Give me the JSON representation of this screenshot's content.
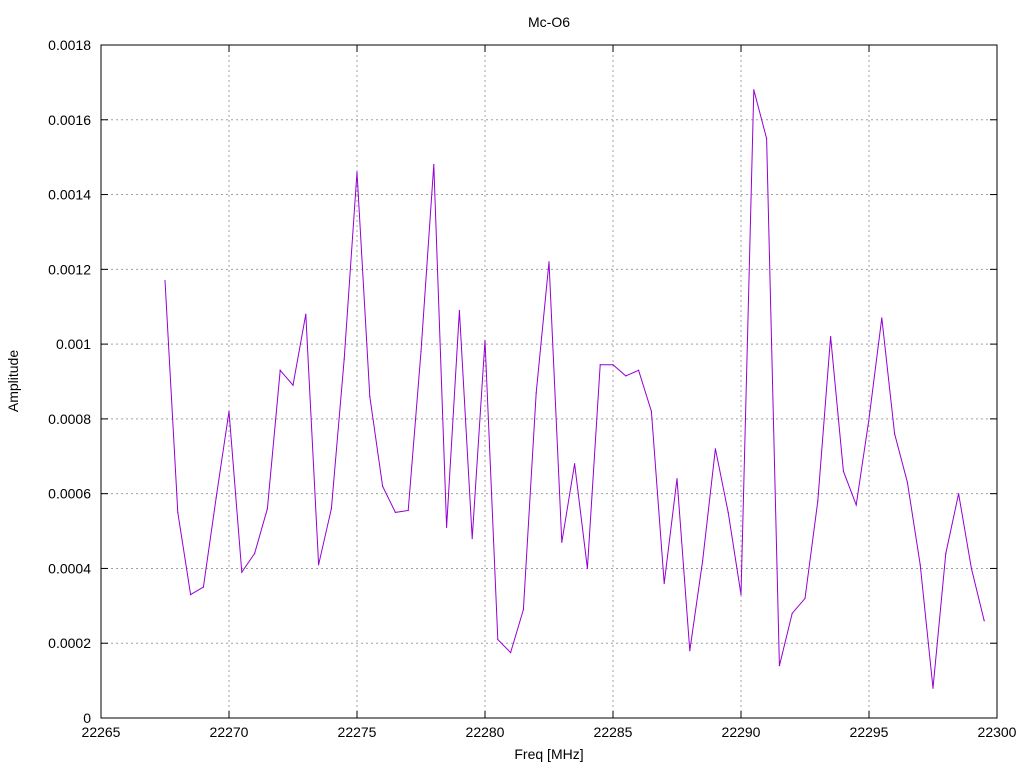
{
  "chart_data": {
    "type": "line",
    "title": "Mc-O6",
    "xlabel": "Freq [MHz]",
    "ylabel": "Amplitude",
    "xlim": [
      22265,
      22300
    ],
    "ylim": [
      0,
      0.0018
    ],
    "x_ticks": [
      "22265",
      "22270",
      "22275",
      "22280",
      "22285",
      "22290",
      "22295",
      "22300"
    ],
    "y_ticks": [
      "0",
      "0.0002",
      "0.0004",
      "0.0006",
      "0.0008",
      "0.001",
      "0.0012",
      "0.0014",
      "0.0016",
      "0.0018"
    ],
    "grid": true,
    "line_color": "#9400d3",
    "series": [
      {
        "x": [
          22267.5,
          22268,
          22268.5,
          22269,
          22269.5,
          22270,
          22270.5,
          22271,
          22271.5,
          22272,
          22272.5,
          22273,
          22273.5,
          22274,
          22274.5,
          22275,
          22275.5,
          22276,
          22276.5,
          22277,
          22277.5,
          22278,
          22278.5,
          22279,
          22279.5,
          22280,
          22280.5,
          22281,
          22281.5,
          22282,
          22282.5,
          22283,
          22283.5,
          22284,
          22284.5,
          22285,
          22285.5,
          22286,
          22286.5,
          22287,
          22287.5,
          22288,
          22288.5,
          22289,
          22289.5,
          22290,
          22290.5,
          22291,
          22291.5,
          22292,
          22292.5,
          22293,
          22293.5,
          22294,
          22294.5,
          22295,
          22295.5,
          22296,
          22296.5,
          22297,
          22297.5,
          22298,
          22298.5,
          22299,
          22299.5
        ],
        "values": [
          0.00117,
          0.00055,
          0.00033,
          0.00035,
          0.00059,
          0.00082,
          0.00039,
          0.00044,
          0.00056,
          0.00093,
          0.00089,
          0.00108,
          0.00041,
          0.00056,
          0.00096,
          0.00146,
          0.00086,
          0.00062,
          0.00055,
          0.000555,
          0.00098,
          0.00148,
          0.00051,
          0.00109,
          0.00048,
          0.00101,
          0.00021,
          0.000175,
          0.00029,
          0.00087,
          0.00122,
          0.00047,
          0.00068,
          0.0004,
          0.000945,
          0.000945,
          0.000915,
          0.00093,
          0.00082,
          0.00036,
          0.00064,
          0.00018,
          0.00042,
          0.00072,
          0.00055,
          0.00033,
          0.00168,
          0.00155,
          0.00014,
          0.00028,
          0.00032,
          0.00058,
          0.00102,
          0.00066,
          0.00057,
          0.0008,
          0.00107,
          0.00076,
          0.00063,
          0.00041,
          8e-05,
          0.00044,
          0.0006,
          0.0004,
          0.00026
        ]
      }
    ]
  }
}
